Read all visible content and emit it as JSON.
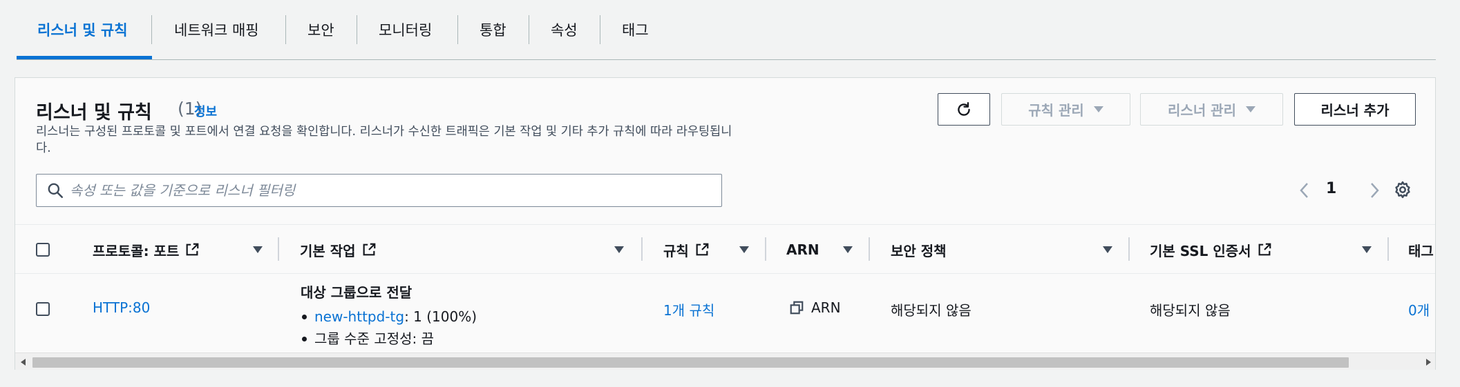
{
  "tabs": [
    {
      "label": "리스너 및 규칙",
      "active": true
    },
    {
      "label": "네트워크 매핑",
      "active": false
    },
    {
      "label": "보안",
      "active": false
    },
    {
      "label": "모니터링",
      "active": false
    },
    {
      "label": "통합",
      "active": false
    },
    {
      "label": "속성",
      "active": false
    },
    {
      "label": "태그",
      "active": false
    }
  ],
  "panel": {
    "title": "리스너 및 규칙",
    "count": "(1)",
    "info_link": "정보",
    "description": "리스너는 구성된 프로토콜 및 포트에서 연결 요청을 확인합니다. 리스너가 수신한 트래픽은 기본 작업 및 기타 추가 규칙에 따라 라우팅됩니다."
  },
  "toolbar": {
    "refresh_icon": "refresh-icon",
    "manage_rules_label": "규칙 관리",
    "manage_listener_label": "리스너 관리",
    "add_listener_label": "리스너 추가"
  },
  "search": {
    "placeholder": "속성 또는 값을 기준으로 리스너 필터링"
  },
  "pagination": {
    "current_page": "1"
  },
  "table": {
    "columns": [
      {
        "label": "프로토콜: 포트",
        "external": true
      },
      {
        "label": "기본 작업",
        "external": true
      },
      {
        "label": "규칙",
        "external": true
      },
      {
        "label": "ARN",
        "external": false
      },
      {
        "label": "보안 정책",
        "external": false
      },
      {
        "label": "기본 SSL 인증서",
        "external": true
      },
      {
        "label": "태그",
        "external": false
      }
    ],
    "rows": [
      {
        "protocol_port": "HTTP:80",
        "default_action_title": "대상 그룹으로 전달",
        "target_group_link": "new-httpd-tg",
        "target_group_weight": ": 1 (100%)",
        "stickiness": "그룹 수준 고정성: 끔",
        "rules": "1개 규칙",
        "arn": "ARN",
        "security_policy": "해당되지 않음",
        "ssl_certificate": "해당되지 않음",
        "tags": "0개"
      }
    ]
  }
}
